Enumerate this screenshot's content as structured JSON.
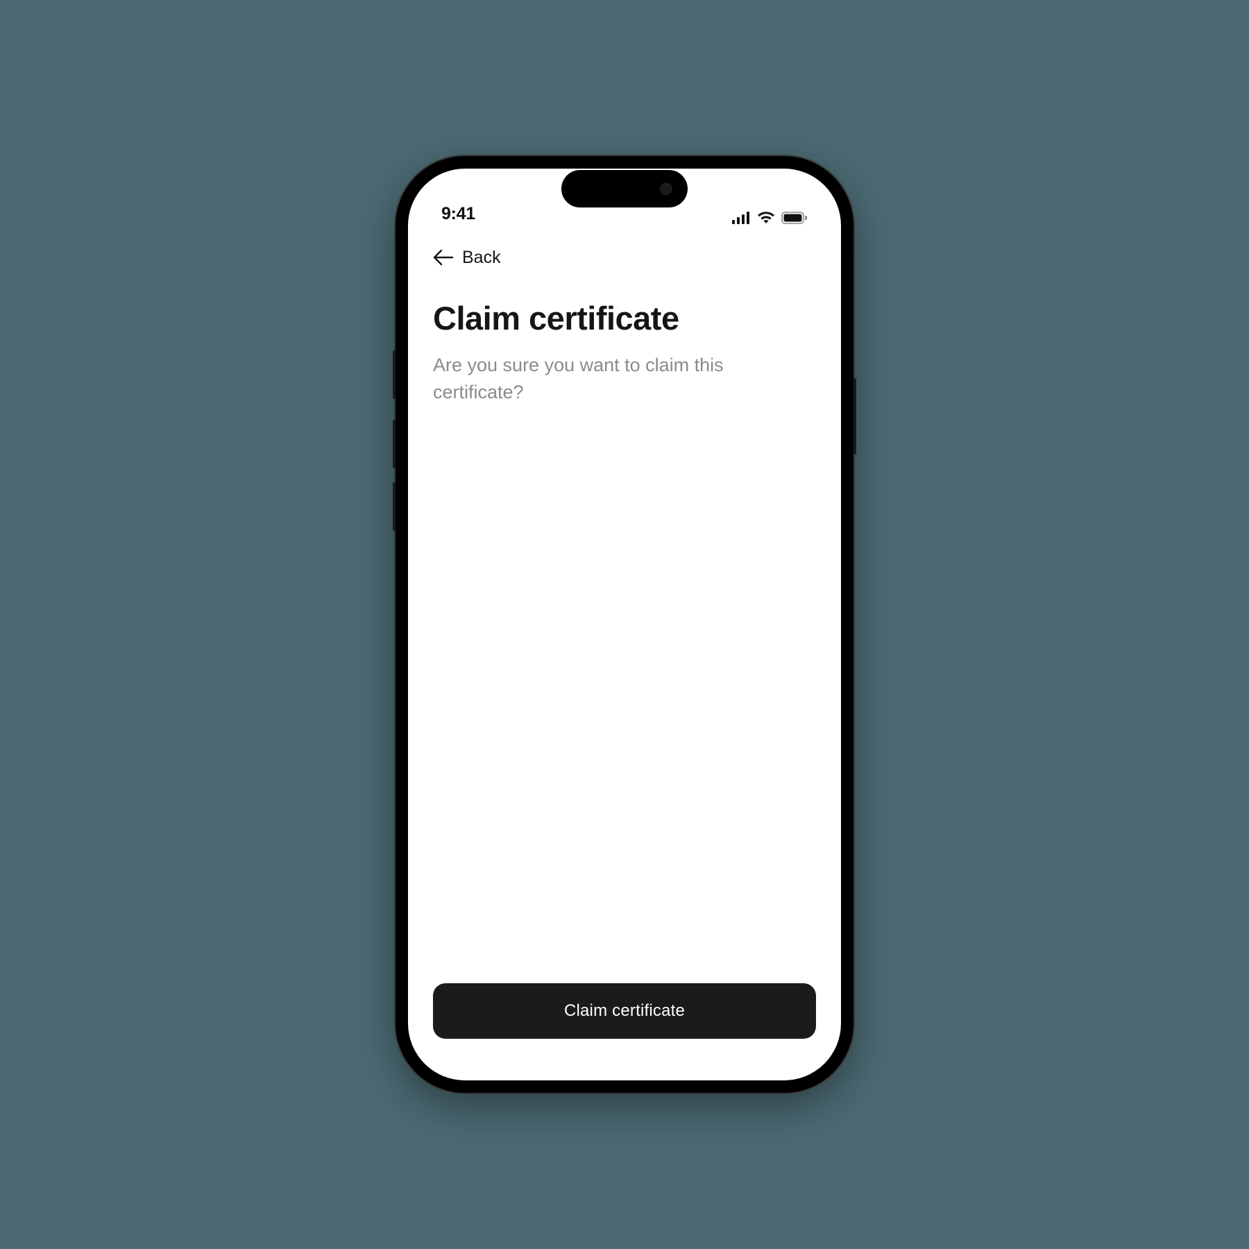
{
  "status_bar": {
    "time": "9:41",
    "icons": {
      "signal": "cellular-signal-icon",
      "wifi": "wifi-icon",
      "battery": "battery-icon"
    }
  },
  "nav": {
    "back_label": "Back",
    "back_icon": "arrow-left-icon"
  },
  "page": {
    "title": "Claim certificate",
    "subtitle": "Are you sure you want to claim this certificate?"
  },
  "actions": {
    "primary_label": "Claim certificate"
  },
  "colors": {
    "background_frame": "#4b6a73",
    "text_primary": "#161616",
    "text_secondary": "#8b8b8b",
    "button_bg": "#1b1b1b",
    "button_text": "#ffffff"
  }
}
